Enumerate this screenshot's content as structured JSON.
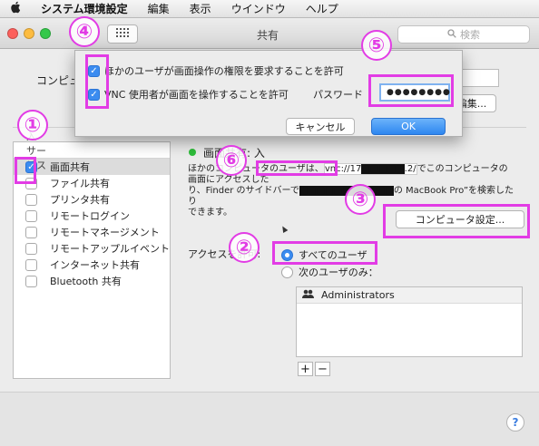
{
  "menubar": {
    "app_name": "システム環境設定",
    "items": [
      "編集",
      "表示",
      "ウインドウ",
      "ヘルプ"
    ]
  },
  "toolbar": {
    "title": "共有",
    "search_placeholder": "検索"
  },
  "computer_name": {
    "label": "コンピュ",
    "edit_label": "編集..."
  },
  "service_list": {
    "header": "入 サービス",
    "items": [
      {
        "label": "画面共有",
        "checked": true,
        "selected": true
      },
      {
        "label": "ファイル共有",
        "checked": false
      },
      {
        "label": "プリンタ共有",
        "checked": false
      },
      {
        "label": "リモートログイン",
        "checked": false
      },
      {
        "label": "リモートマネージメント",
        "checked": false
      },
      {
        "label": "リモートアップルイベント",
        "checked": false
      },
      {
        "label": "インターネット共有",
        "checked": false
      },
      {
        "label": "Bluetooth 共有",
        "checked": false
      }
    ]
  },
  "main": {
    "status": "画面共有: 入",
    "desc_line1_a": "ほかのコンピュータのユーザは、",
    "vnc_address": "vnc://17",
    "vnc_tail": ".2/",
    "desc_line1_b": "でこのコンピュータの画面にアクセスした",
    "desc_line2_a": "り、Finder のサイドバーで",
    "desc_line2_b": "の MacBook Pro”を検索したり",
    "desc_line3": "できます。",
    "computer_settings_label": "コンピュータ設定...",
    "access_label": "アクセスを許可:",
    "radio_all": "すべてのユーザ",
    "radio_only": "次のユーザのみ：",
    "users_header": "Administrators",
    "add_label": "+",
    "remove_label": "−",
    "help_label": "?"
  },
  "dialog": {
    "option1": "ほかのユーザが画面操作の権限を要求することを許可",
    "option2": "VNC 使用者が画面を操作することを許可",
    "option1_checked": true,
    "option2_checked": true,
    "password_label": "パスワード",
    "password_value": "●●●●●●●●",
    "cancel_label": "キャンセル",
    "ok_label": "OK"
  },
  "annotations": [
    "①",
    "②",
    "③",
    "④",
    "⑤",
    "⑥"
  ],
  "colors": {
    "annotation": "#e23ce5",
    "accent": "#3b8cf0",
    "status_green": "#2ebd3a"
  }
}
